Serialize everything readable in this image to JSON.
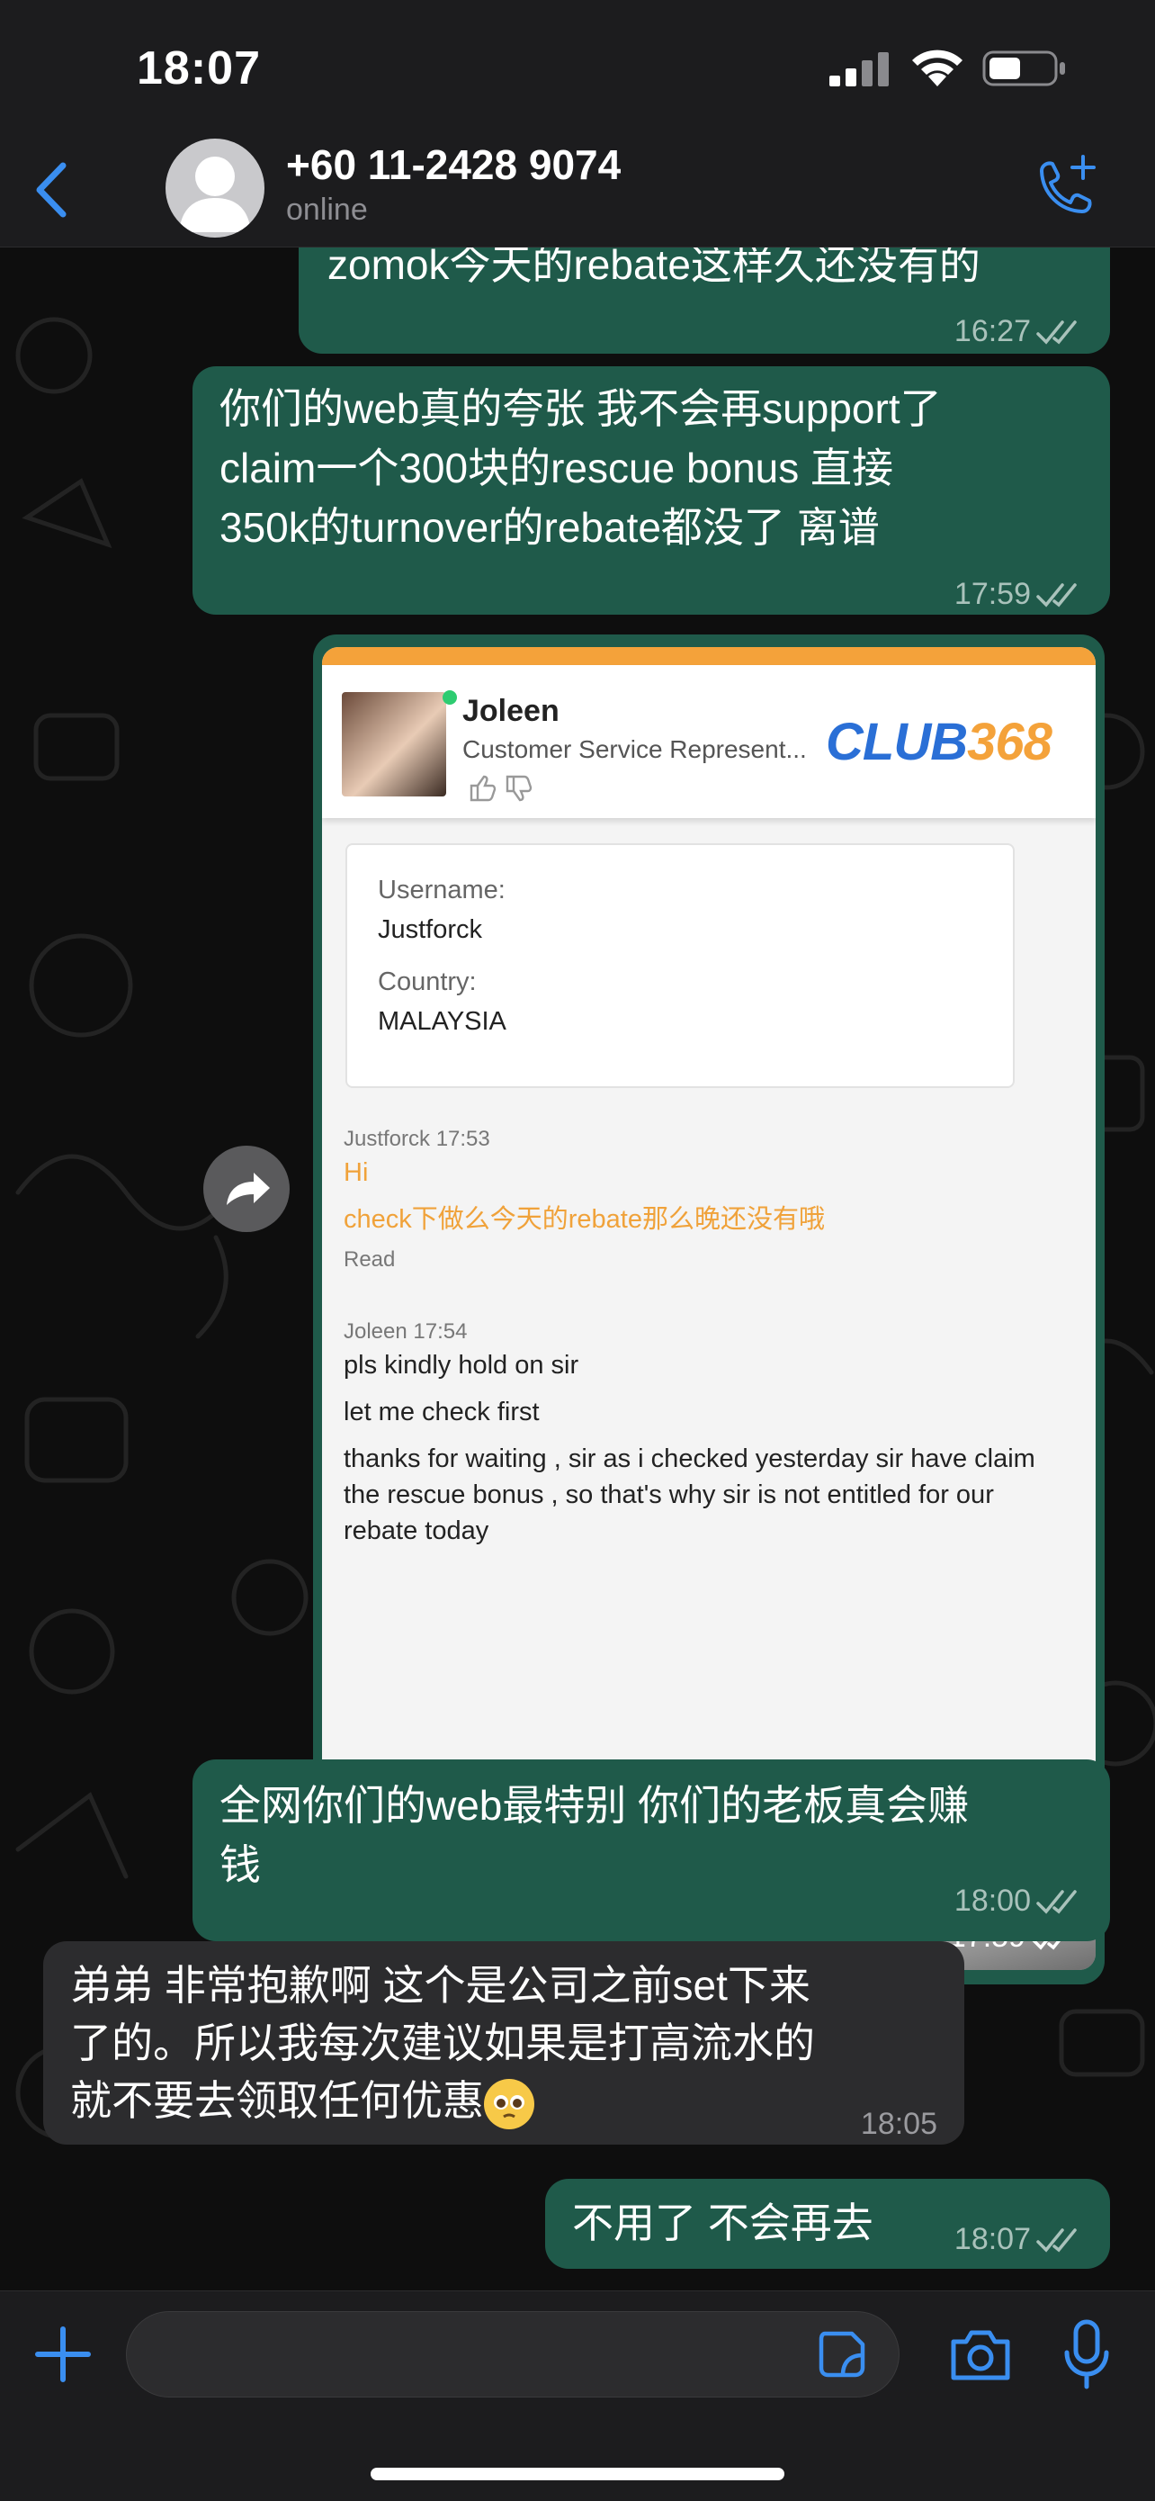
{
  "status_bar": {
    "time": "18:07"
  },
  "header": {
    "contact": "+60 11-2428 9074",
    "status": "online"
  },
  "messages": [
    {
      "text": "zomok今天的rebate这样久还没有的",
      "time": "16:27",
      "dir": "out"
    },
    {
      "lines": [
        "你们的web真的夸张 我不会再support了",
        "claim一个300块的rescue bonus 直接",
        "350k的turnover的rebate都没了 离谱"
      ],
      "time": "17:59",
      "dir": "out"
    },
    {
      "time": "17:59",
      "dir": "out",
      "type": "image"
    },
    {
      "lines": [
        "全网你们的web最特别 你们的老板真会赚",
        "钱"
      ],
      "time": "18:00",
      "dir": "out"
    },
    {
      "lines": [
        "弟弟 非常抱歉啊 这个是公司之前set下来",
        "了的。所以我每次建议如果是打高流水的",
        "就不要去领取任何优惠"
      ],
      "emoji": "pleading-face",
      "time": "18:05",
      "dir": "in"
    },
    {
      "text": "不用了 不会再去",
      "time": "18:07",
      "dir": "out"
    }
  ],
  "screenshot": {
    "agent_name": "Joleen",
    "agent_title": "Customer Service Represent...",
    "logo_text": "LUB",
    "logo_prefix": "C",
    "logo_num": "368",
    "username_label": "Username:",
    "username": "Justforck",
    "country_label": "Country:",
    "country": "MALAYSIA",
    "log": [
      {
        "text": "Justforck 17:53",
        "style": "small"
      },
      {
        "text": "Hi",
        "style": "orange"
      },
      {
        "text": "check下做么今天的rebate那么晚还没有哦",
        "style": "orange"
      },
      {
        "text": "Read",
        "style": "small"
      },
      {
        "text": "Joleen 17:54",
        "style": "small"
      },
      {
        "text": "pls kindly hold on sir",
        "style": "normal"
      },
      {
        "text": "let me check first",
        "style": "normal"
      },
      {
        "text": "thanks for waiting , sir as i checked yesterday sir have claim",
        "style": "normal"
      },
      {
        "text": "the rescue bonus , so that's why sir is not entitled for our",
        "style": "normal"
      },
      {
        "text": "rebate today",
        "style": "normal"
      }
    ]
  },
  "colors": {
    "outgoing": "#1f5a4a",
    "incoming": "#2c2c2e",
    "accent": "#3a8ef0"
  }
}
